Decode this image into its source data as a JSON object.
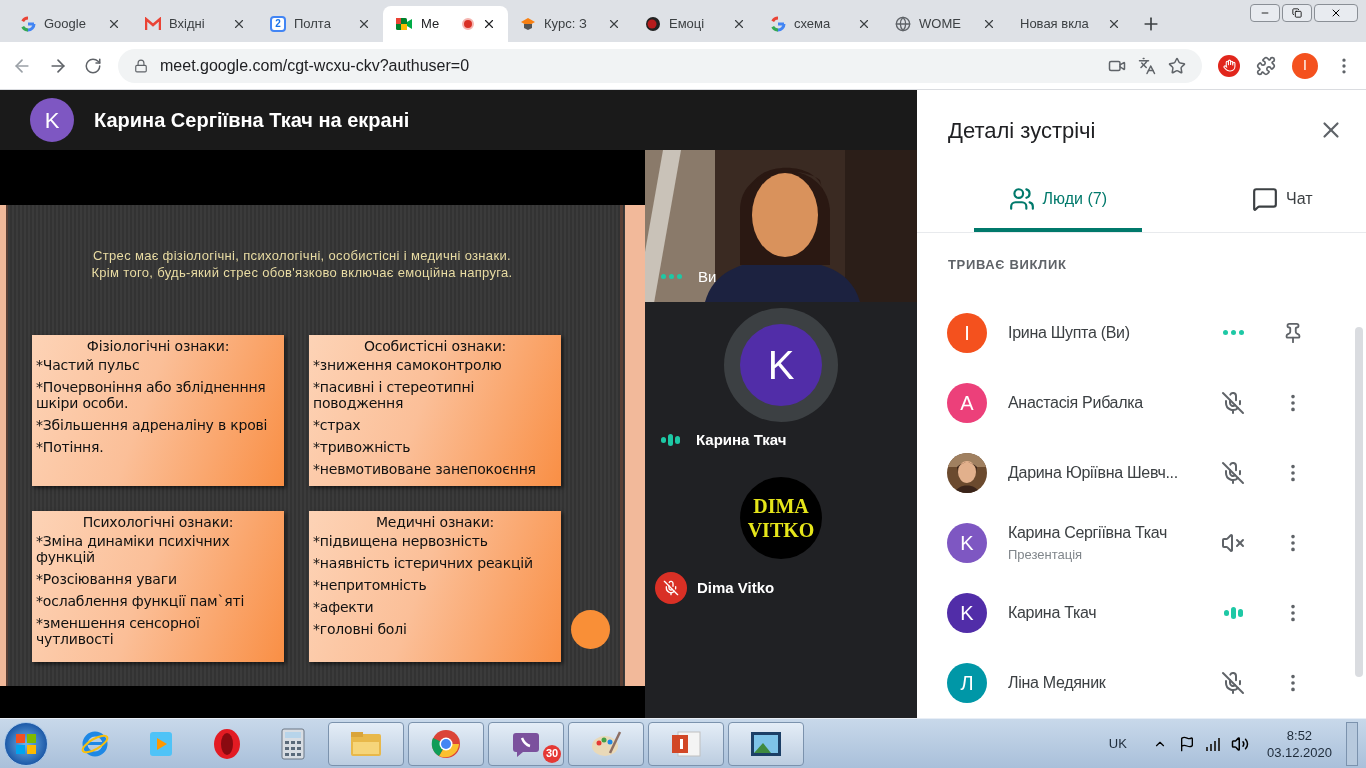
{
  "browser": {
    "tabs": [
      {
        "title": "Google",
        "kind": "google",
        "selected": false,
        "recording": false
      },
      {
        "title": "Вхідні",
        "kind": "gmail",
        "selected": false,
        "recording": false
      },
      {
        "title": "Полта",
        "kind": "calendar",
        "badge": "2",
        "selected": false,
        "recording": false
      },
      {
        "title": "Ме",
        "kind": "meet",
        "selected": true,
        "recording": true
      },
      {
        "title": "Курс: З",
        "kind": "course",
        "selected": false,
        "recording": false
      },
      {
        "title": "Емоці",
        "kind": "record",
        "selected": false,
        "recording": false
      },
      {
        "title": "схема",
        "kind": "google",
        "selected": false,
        "recording": false
      },
      {
        "title": "WOME",
        "kind": "globe",
        "selected": false,
        "recording": false
      },
      {
        "title": "Новая вкла",
        "kind": "blank",
        "selected": false,
        "recording": false
      }
    ],
    "url": "meet.google.com/cgt-wcxu-ckv?authuser=0",
    "profile_letter": "I"
  },
  "presenter": {
    "avatar_letter": "K",
    "title": "Карина Сергіївна Ткач на екрані"
  },
  "slide": {
    "heading": [
      "Стрес має фізіологічні, психологічні, особистісні і медичні ознаки.",
      "Крім того, будь-який стрес обов'язково включає емоційна напруга."
    ],
    "boxes": [
      {
        "title": "Фізіологічні ознаки:",
        "items": [
          "*Частий пульс",
          "*Почервоніння або зблідненння шкіри особи.",
          "*Збільшення адреналіну в крові",
          "*Потіння."
        ]
      },
      {
        "title": "Особистісні ознаки:",
        "items": [
          "*зниження самоконтролю",
          "*пасивні і стереотипні поводження",
          "*страх",
          "*тривожність",
          "*невмотивоване занепокоєння"
        ]
      },
      {
        "title": "Психологічні ознаки:",
        "items": [
          "*Зміна динаміки психічних функцій",
          "*Розсіювання уваги",
          "*ослаблення функції пам`яті",
          "*зменшення сенсорної чутливості"
        ]
      },
      {
        "title": "Медичні ознаки:",
        "items": [
          "*підвищена нервозність",
          "*наявність істеричних реакцій",
          "*непритомність",
          "*афекти",
          "*головні болі"
        ]
      }
    ]
  },
  "tiles": [
    {
      "kind": "video",
      "name": "Ви",
      "status": {
        "kind": "speaking-dots"
      }
    },
    {
      "kind": "avatar",
      "name": "Карина Ткач",
      "status": {
        "kind": "speaking-bars"
      },
      "avatar_letter": "K"
    },
    {
      "kind": "logo",
      "name": "Dima Vitko",
      "status": {
        "kind": "mic-off"
      },
      "logo_lines": [
        "DIMA",
        "VITKO"
      ]
    }
  ],
  "panel": {
    "title": "Деталі зустрічі",
    "tabs": [
      {
        "label": "Люди (7)",
        "kind": "people",
        "selected": true
      },
      {
        "label": "Чат",
        "kind": "chat",
        "selected": false
      }
    ],
    "section": "ТРИВАЄ ВИКЛИК",
    "participants": [
      {
        "name": "Ірина Шупта (Ви)",
        "avatar": {
          "letter": "I",
          "color": "#f4511e"
        },
        "status": {
          "kind": "speaking-dots"
        },
        "action": {
          "kind": "pin"
        }
      },
      {
        "name": "Анастасія Рибалка",
        "avatar": {
          "letter": "A",
          "color": "#ec407a"
        },
        "status": {
          "kind": "mic-off"
        },
        "action": {
          "kind": "more"
        }
      },
      {
        "name": "Дарина Юріївна Шевч...",
        "status": {
          "kind": "mic-off"
        },
        "action": {
          "kind": "more"
        }
      },
      {
        "name": "Карина Сергіївна Ткач",
        "subtitle": "Презентація",
        "avatar": {
          "letter": "K",
          "color": "#7e57c2"
        },
        "status": {
          "kind": "audio-off"
        },
        "action": {
          "kind": "more"
        }
      },
      {
        "name": "Карина Ткач",
        "avatar": {
          "letter": "K",
          "color": "#512da8"
        },
        "status": {
          "kind": "speaking-bars"
        },
        "action": {
          "kind": "more"
        }
      },
      {
        "name": "Ліна Медяник",
        "avatar": {
          "letter": "Л",
          "color": "#0097a7"
        },
        "status": {
          "kind": "mic-off"
        },
        "action": {
          "kind": "more"
        }
      }
    ]
  },
  "taskbar": {
    "apps": [
      {
        "kind": "ie",
        "pressed": false
      },
      {
        "kind": "media",
        "pressed": false
      },
      {
        "kind": "opera",
        "pressed": false
      },
      {
        "kind": "calculator",
        "pressed": false
      },
      {
        "kind": "explorer",
        "pressed": true
      },
      {
        "kind": "chrome",
        "pressed": true
      },
      {
        "kind": "viber",
        "pressed": true,
        "badge": "30"
      },
      {
        "kind": "paint",
        "pressed": true
      },
      {
        "kind": "powerpoint",
        "pressed": true
      },
      {
        "kind": "photos",
        "pressed": true
      }
    ],
    "language": "UK",
    "time": "8:52",
    "date": "03.12.2020"
  }
}
